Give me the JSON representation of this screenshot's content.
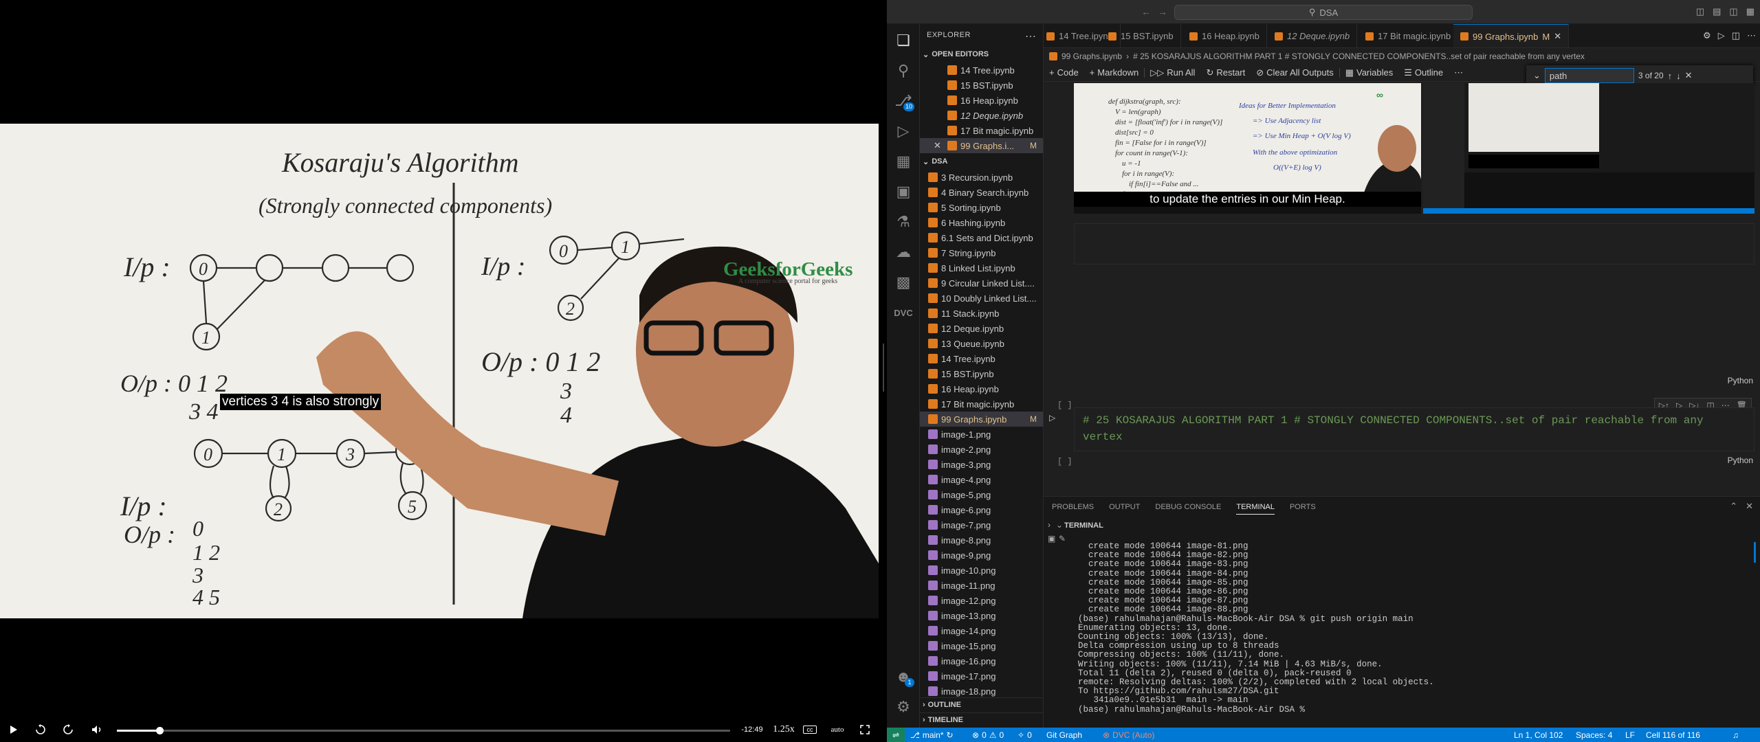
{
  "video": {
    "caption": "vertices 3 4 is also strongly",
    "brand": "GeeksforGeeks",
    "brand_tagline": "A computer science portal for geeks",
    "time_remaining": "-12:49",
    "playback_speed": "1.25x",
    "cc_label": "cc",
    "quality_label": "auto",
    "progress": 0.07
  },
  "vscode": {
    "search_text": "DSA",
    "explorer_title": "EXPLORER",
    "open_editors_label": "OPEN EDITORS",
    "open_editors": [
      {
        "name": "14 Tree.ipynb",
        "italic": false
      },
      {
        "name": "15 BST.ipynb",
        "italic": false
      },
      {
        "name": "16 Heap.ipynb",
        "italic": false
      },
      {
        "name": "12 Deque.ipynb",
        "italic": true
      },
      {
        "name": "17 Bit magic.ipynb",
        "italic": false
      },
      {
        "name": "99 Graphs.i...",
        "italic": false,
        "modified": "M"
      }
    ],
    "folder_label": "DSA",
    "files": [
      "3 Recursion.ipynb",
      "4 Binary Search.ipynb",
      "5 Sorting.ipynb",
      "6 Hashing.ipynb",
      "6.1 Sets and Dict.ipynb",
      "7 String.ipynb",
      "8 Linked List.ipynb",
      "9 Circular Linked List....",
      "10 Doubly Linked List....",
      "11 Stack.ipynb",
      "12 Deque.ipynb",
      "13 Queue.ipynb",
      "14 Tree.ipynb",
      "15 BST.ipynb",
      "16 Heap.ipynb",
      "17 Bit magic.ipynb",
      "99 Graphs.ipynb"
    ],
    "active_file_modified": "M",
    "images": [
      "image-1.png",
      "image-2.png",
      "image-3.png",
      "image-4.png",
      "image-5.png",
      "image-6.png",
      "image-7.png",
      "image-8.png",
      "image-9.png",
      "image-10.png",
      "image-11.png",
      "image-12.png",
      "image-13.png",
      "image-14.png",
      "image-15.png",
      "image-16.png",
      "image-17.png",
      "image-18.png"
    ],
    "outline_label": "OUTLINE",
    "timeline_label": "TIMELINE",
    "activity_badges": {
      "scm": "10",
      "accounts": "1"
    },
    "tabs": [
      "14 Tree.ipynb",
      "15 BST.ipynb",
      "16 Heap.ipynb",
      "12 Deque.ipynb",
      "17 Bit magic.ipynb",
      "99 Graphs.ipynb"
    ],
    "active_tab_badge": "M",
    "breadcrumb": [
      "99 Graphs.ipynb",
      "# 25 KOSARAJUS ALGORITHM PART 1 # STONGLY CONNECTED COMPONENTS..set of pair reachable from any vertex"
    ],
    "toolbar": {
      "code": "Code",
      "markdown": "Markdown",
      "run_all": "Run All",
      "restart": "Restart",
      "clear": "Clear All Outputs",
      "variables": "Variables",
      "outline": "Outline"
    },
    "find": {
      "query": "path",
      "result": "3 of 20"
    },
    "output_caption": "to update the entries in our Min Heap.",
    "cell_bracket": "[ ]",
    "lang": "Python",
    "markdown_cell": "# 25 KOSARAJUS ALGORITHM PART 1 # STONGLY CONNECTED COMPONENTS..set of pair reachable from any vertex",
    "panel_tabs": [
      "PROBLEMS",
      "OUTPUT",
      "DEBUG CONSOLE",
      "TERMINAL",
      "PORTS"
    ],
    "terminal_label": "TERMINAL",
    "terminal": [
      "  create mode 100644 image-81.png",
      "  create mode 100644 image-82.png",
      "  create mode 100644 image-83.png",
      "  create mode 100644 image-84.png",
      "  create mode 100644 image-85.png",
      "  create mode 100644 image-86.png",
      "  create mode 100644 image-87.png",
      "  create mode 100644 image-88.png",
      "(base) rahulmahajan@Rahuls-MacBook-Air DSA % git push origin main",
      "Enumerating objects: 13, done.",
      "Counting objects: 100% (13/13), done.",
      "Delta compression using up to 8 threads",
      "Compressing objects: 100% (11/11), done.",
      "Writing objects: 100% (11/11), 7.14 MiB | 4.63 MiB/s, done.",
      "Total 11 (delta 2), reused 0 (delta 0), pack-reused 0",
      "remote: Resolving deltas: 100% (2/2), completed with 2 local objects.",
      "To https://github.com/rahulsm27/DSA.git",
      "   341a0e9..01e5b31  main -> main",
      "(base) rahulmahajan@Rahuls-MacBook-Air DSA % "
    ],
    "status": {
      "branch": "main*",
      "errors": "0",
      "warnings": "0",
      "info": "0",
      "git_graph": "Git Graph",
      "dvc": "DVC (Auto)",
      "position": "Ln 1, Col 102",
      "spaces": "Spaces: 4",
      "eol": "LF",
      "cell": "Cell 116 of 116"
    }
  }
}
